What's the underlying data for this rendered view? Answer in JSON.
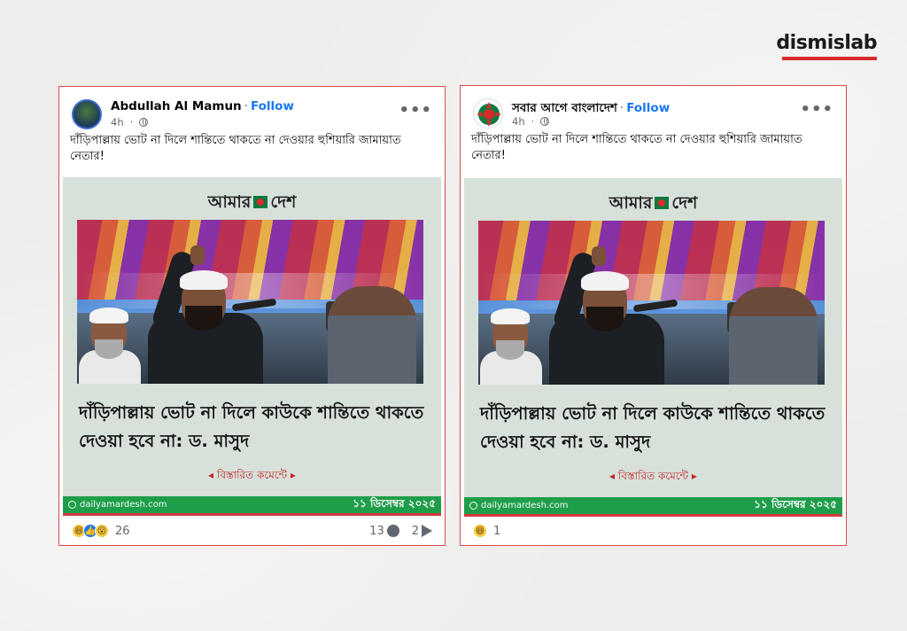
{
  "brand": {
    "logo": "dismislab",
    "accent_color": "#d62b2b"
  },
  "posts": [
    {
      "author": "Abdullah Al Mamun",
      "follow_label": "Follow",
      "time": "4h",
      "more_icon": "more-horizontal-icon",
      "caption": "দাঁড়িপাল্লায় ভোট না দিলে শান্তিতে থাকতে না দেওয়ার হুশিয়ারি জামায়াত নেতার!",
      "card": {
        "brand_left": "আমার",
        "brand_right": "দেশ",
        "headline": "দাঁড়িপাল্লায় ভোট না দিলে কাউকে শান্তিতে থাকতে দেওয়া হবে না: ড. মাসুদ",
        "details": "◂ বিস্তারিত কমেন্টে ▸",
        "site": "dailyamardesh.com",
        "date": "১১ ডিসেম্বর ২০২৫"
      },
      "reaction_count": "26",
      "comment_count": "13",
      "share_count": "2"
    },
    {
      "author": "সবার আগে বাংলাদেশ",
      "follow_label": "Follow",
      "time": "4h",
      "more_icon": "more-horizontal-icon",
      "caption": "দাঁড়িপাল্লায় ভোট না দিলে শান্তিতে থাকতে না দেওয়ার হুশিয়ারি জামায়াত নেতার!",
      "card": {
        "brand_left": "আমার",
        "brand_right": "দেশ",
        "headline": "দাঁড়িপাল্লায় ভোট না দিলে কাউকে শান্তিতে থাকতে দেওয়া হবে না: ড. মাসুদ",
        "details": "◂ বিস্তারিত কমেন্টে ▸",
        "site": "dailyamardesh.com",
        "date": "১১ ডিসেম্বর ২০২৫"
      },
      "reaction_count": "1"
    }
  ]
}
